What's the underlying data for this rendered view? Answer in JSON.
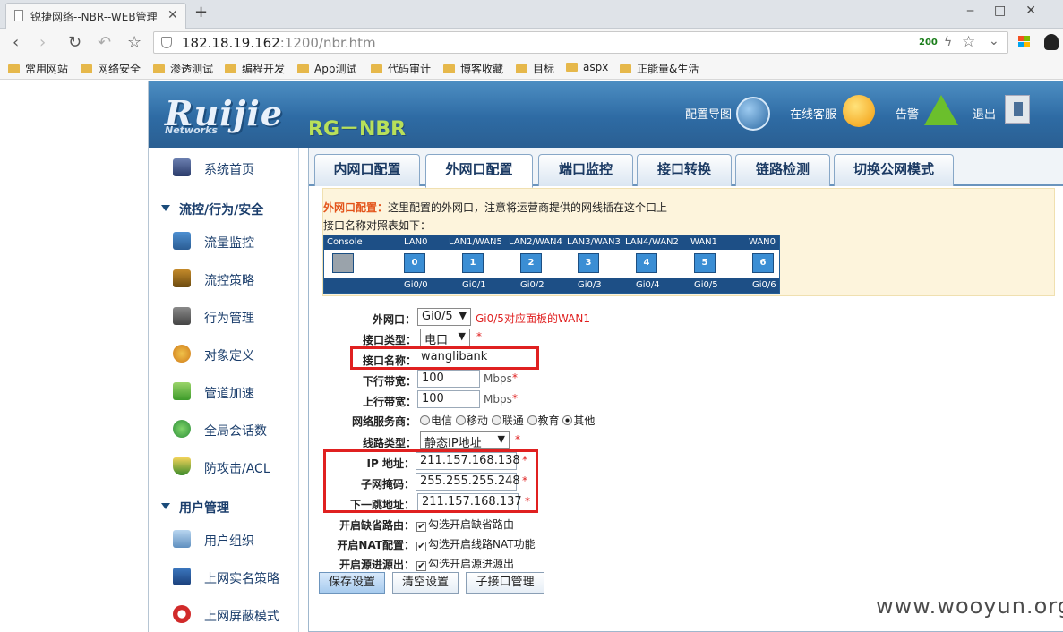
{
  "browser": {
    "tab_title": "锐捷网络--NBR--WEB管理",
    "url_host": "182.18.19.162",
    "url_path": ":1200/nbr.htm",
    "status_code": "200",
    "bookmarks": [
      "常用网站",
      "网络安全",
      "渗透测试",
      "编程开发",
      "App测试",
      "代码审计",
      "博客收藏",
      "目标",
      "aspx",
      "正能量&生活"
    ]
  },
  "header": {
    "logo": "Ruijie",
    "logo_sub": "Networks",
    "model": "RG－NBR",
    "links": {
      "guide": "配置导图",
      "support": "在线客服",
      "alarm": "告警",
      "logout": "退出"
    }
  },
  "sidebar": {
    "home": "系统首页",
    "group1": "流控/行为/安全",
    "group1_items": [
      "流量监控",
      "流控策略",
      "行为管理",
      "对象定义",
      "管道加速",
      "全局会话数",
      "防攻击/ACL"
    ],
    "group2": "用户管理",
    "group2_items": [
      "用户组织",
      "上网实名策略",
      "上网屏蔽模式"
    ]
  },
  "tabs": [
    "内网口配置",
    "外网口配置",
    "端口监控",
    "接口转换",
    "链路检测",
    "切换公网模式"
  ],
  "info": {
    "title": "外网口配置：",
    "desc": "这里配置的外网口，注意将运营商提供的网线插在这个口上",
    "map_title": "接口名称对照表如下：",
    "map_top": [
      "Console",
      "LAN0",
      "LAN1/WAN5",
      "LAN2/WAN4",
      "LAN3/WAN3",
      "LAN4/WAN2",
      "WAN1",
      "WAN0"
    ],
    "map_ports": [
      "0",
      "1",
      "2",
      "3",
      "4",
      "5",
      "6"
    ],
    "map_bottom": [
      "Gi0/0",
      "Gi0/1",
      "Gi0/2",
      "Gi0/3",
      "Gi0/4",
      "Gi0/5",
      "Gi0/6"
    ]
  },
  "form": {
    "wan_label": "外网口：",
    "wan_value": "Gi0/5",
    "wan_note": "Gi0/5对应面板的WAN1",
    "itype_label": "接口类型：",
    "itype_value": "电口",
    "iname_label": "接口名称：",
    "iname_value": "wanglibank",
    "down_label": "下行带宽：",
    "down_value": "100",
    "down_unit": "Mbps",
    "up_label": "上行带宽：",
    "up_value": "100",
    "up_unit": "Mbps",
    "isp_label": "网络服务商：",
    "isp_options": [
      "电信",
      "移动",
      "联通",
      "教育",
      "其他"
    ],
    "isp_selected": "其他",
    "line_label": "线路类型：",
    "line_value": "静态IP地址",
    "ip_label": "IP 地址：",
    "ip_value": "211.157.168.138",
    "mask_label": "子网掩码：",
    "mask_value": "255.255.255.248",
    "gw_label": "下一跳地址：",
    "gw_value": "211.157.168.137",
    "defroute_label": "开启缺省路由：",
    "defroute_text": "勾选开启缺省路由",
    "nat_label": "开启NAT配置：",
    "nat_text": "勾选开启线路NAT功能",
    "src_label": "开启源进源出：",
    "src_text": "勾选开启源进源出",
    "required": "*"
  },
  "buttons": {
    "save": "保存设置",
    "clear": "清空设置",
    "sub": "子接口管理"
  },
  "watermark": "www.wooyun.org"
}
